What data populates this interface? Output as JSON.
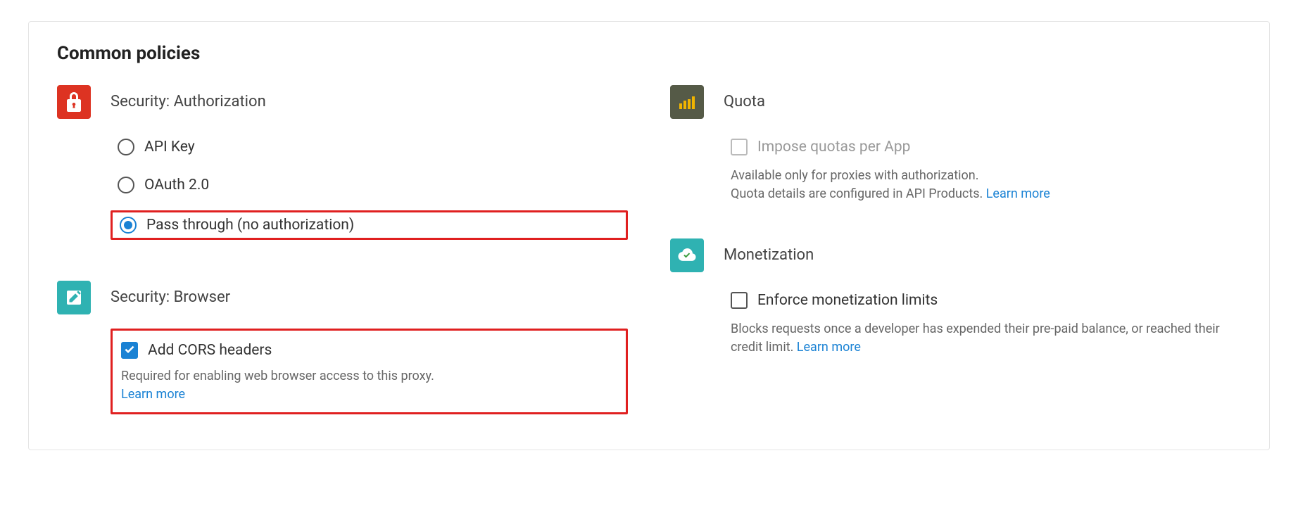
{
  "heading": "Common policies",
  "left_col": {
    "security_auth": {
      "title": "Security: Authorization",
      "options": {
        "api_key": "API Key",
        "oauth": "OAuth 2.0",
        "pass_through": "Pass through (no authorization)"
      }
    },
    "security_browser": {
      "title": "Security: Browser",
      "cors_label": "Add CORS headers",
      "helper_prefix": "Required for enabling web browser access to this proxy.",
      "learn_more": "Learn more"
    }
  },
  "right_col": {
    "quota": {
      "title": "Quota",
      "checkbox_label": "Impose quotas per App",
      "helper_line1": "Available only for proxies with authorization.",
      "helper_line2_prefix": "Quota details are configured in API Products. ",
      "learn_more": "Learn more"
    },
    "monetization": {
      "title": "Monetization",
      "checkbox_label": "Enforce monetization limits",
      "helper_prefix": "Blocks requests once a developer has expended their pre-paid balance, or reached their credit limit. ",
      "learn_more": "Learn more"
    }
  }
}
